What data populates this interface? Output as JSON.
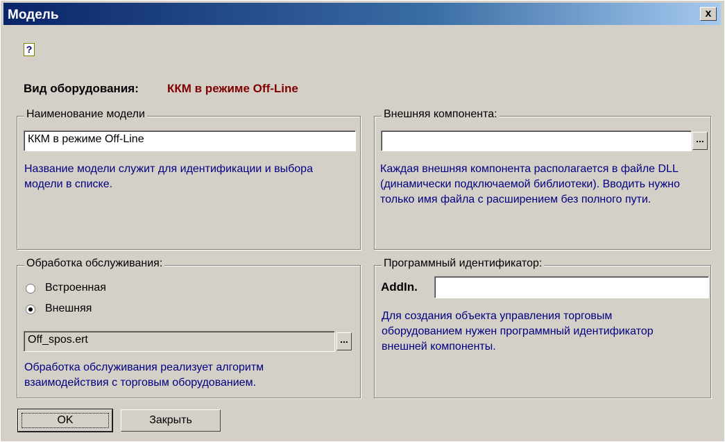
{
  "window": {
    "title": "Модель",
    "close_label": "x"
  },
  "help_icon": "?",
  "equipment": {
    "label": "Вид оборудования:",
    "value": "ККМ в режиме Off-Line"
  },
  "model_group": {
    "legend": "Наименование модели",
    "value": "ККМ в режиме Off-Line",
    "hint": "Название модели служит для идентификации и выбора модели в списке."
  },
  "external_group": {
    "legend": "Внешняя компонента:",
    "value": "",
    "browse_label": "...",
    "hint": "Каждая внешняя компонента располагается в файле DLL (динамически подключаемой библиотеки). Вводить нужно только имя файла с расширением без полного пути."
  },
  "processing_group": {
    "legend": "Обработка обслуживания:",
    "option_builtin": "Встроенная",
    "option_external": "Внешняя",
    "selected": "Внешняя",
    "file_value": "Off_spos.ert",
    "browse_label": "...",
    "hint": "Обработка обслуживания реализует алгоритм взаимодействия с торговым оборудованием."
  },
  "progid_group": {
    "legend": "Программный идентификатор:",
    "prefix": "AddIn.",
    "value": "",
    "hint": "Для создания объекта управления торговым оборудованием нужен программный идентификатор внешней компоненты."
  },
  "buttons": {
    "ok": "OK",
    "close": "Закрыть"
  },
  "colors": {
    "title_bar": "#0a246a",
    "accent_value": "#800000",
    "hint_text": "#000080",
    "face": "#d4d0c8"
  }
}
